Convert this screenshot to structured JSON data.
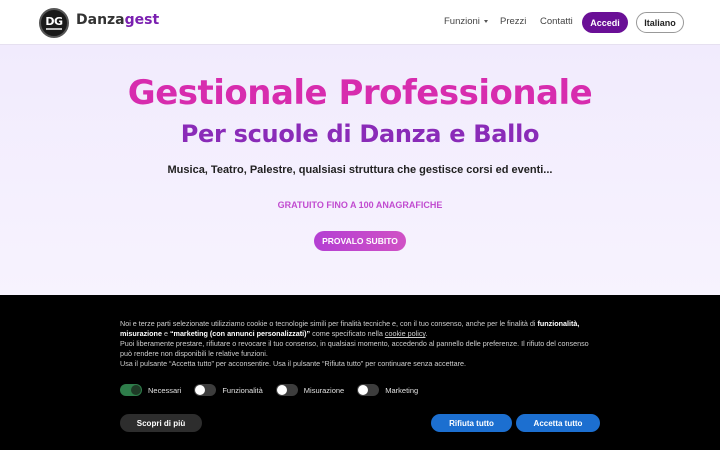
{
  "navbar": {
    "logo_letters": "DG",
    "brand_part1": "Danza",
    "brand_part2": "gest",
    "links": {
      "funzioni": "Funzioni",
      "prezzi": "Prezzi",
      "contatti": "Contatti"
    },
    "login_label": "Accedi",
    "language_label": "Italiano"
  },
  "hero": {
    "title": "Gestionale Professionale",
    "subtitle": "Per scuole di Danza e Ballo",
    "description": "Musica, Teatro, Palestre, qualsiasi struttura che gestisce corsi ed eventi...",
    "free_note": "GRATUITO FINO A 100 ANAGRAFICHE",
    "cta_label": "PROVALO SUBITO"
  },
  "cookie_banner": {
    "p1_a": "Noi e terze parti selezionate utilizziamo cookie o tecnologie simili per finalità tecniche e, con il tuo consenso, anche per le finalità di ",
    "p1_b": "funzionalità, misurazione",
    "p1_c": " e ",
    "p1_d": "“marketing (con annunci personalizzati)”",
    "p1_e": " come specificato nella ",
    "p1_link": "cookie policy",
    "p1_f": ".",
    "p2": "Puoi liberamente prestare, rifiutare o revocare il tuo consenso, in qualsiasi momento, accedendo al pannello delle preferenze. Il rifiuto del consenso può rendere non disponibili le relative funzioni.",
    "p3": "Usa il pulsante “Accetta tutto” per acconsentire. Usa il pulsante “Rifiuta tutto” per continuare senza accettare.",
    "toggles": [
      {
        "label": "Necessari",
        "on": true
      },
      {
        "label": "Funzionalità",
        "on": false
      },
      {
        "label": "Misurazione",
        "on": false
      },
      {
        "label": "Marketing",
        "on": false
      }
    ],
    "more_label": "Scopri di più",
    "reject_label": "Rifiuta tutto",
    "accept_label": "Accetta tutto"
  },
  "colors": {
    "brand_purple": "#6a0f96",
    "title_pink": "#d72cae",
    "subtitle_purple": "#8a2bb8",
    "cookie_button_blue": "#1c6fd0"
  }
}
